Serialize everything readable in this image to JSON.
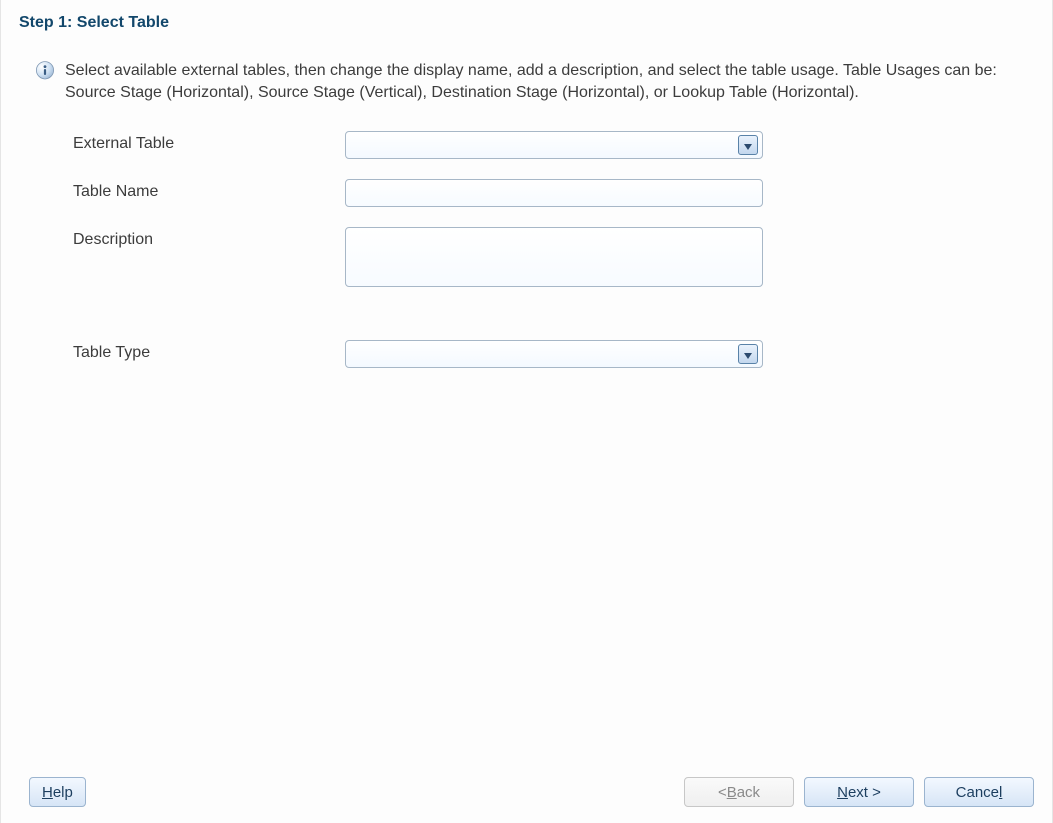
{
  "header": {
    "title": "Step 1: Select Table"
  },
  "info": {
    "text": "Select available external tables, then change the display name, add a description, and select the table usage. Table Usages can be: Source Stage (Horizontal), Source Stage (Vertical), Destination Stage (Horizontal), or Lookup Table (Horizontal)."
  },
  "fields": {
    "external_table": {
      "label": "External Table",
      "value": ""
    },
    "table_name": {
      "label": "Table Name",
      "value": ""
    },
    "description": {
      "label": "Description",
      "value": ""
    },
    "table_type": {
      "label": "Table Type",
      "value": ""
    }
  },
  "footer": {
    "help": {
      "prefix": "",
      "mnemonic": "H",
      "suffix": "elp"
    },
    "back": {
      "prefix": "< ",
      "mnemonic": "B",
      "suffix": "ack"
    },
    "next": {
      "prefix": "",
      "mnemonic": "N",
      "suffix": "ext >"
    },
    "cancel": {
      "prefix": "Cance",
      "mnemonic": "l",
      "suffix": ""
    }
  }
}
